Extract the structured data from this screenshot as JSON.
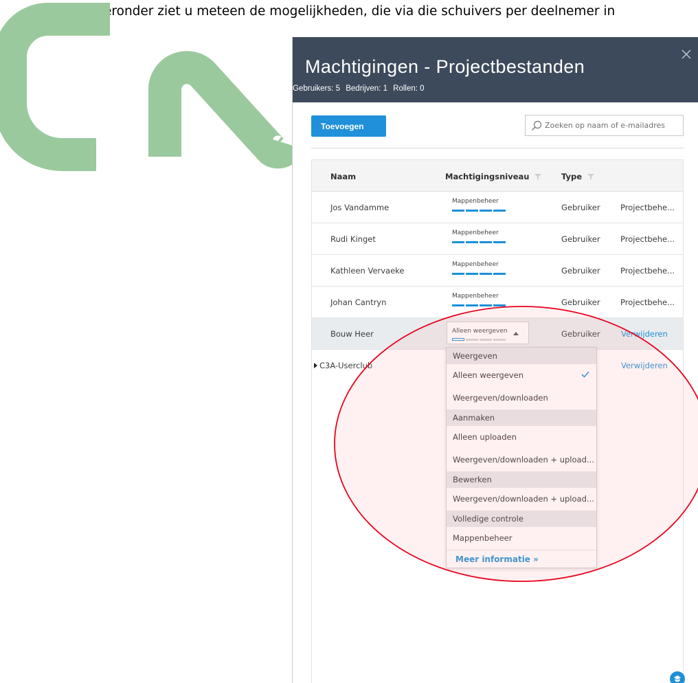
{
  "caption": "Hieronder ziet u meteen de mogelijkheden, die via die schuivers per deelnemer in",
  "colors": {
    "logo_green": "#9bc99e",
    "header_bg": "#3d4a5c",
    "accent": "#1f90d9",
    "annotation": "#e8001c"
  },
  "panel": {
    "title": "Machtigingen - Projectbestanden",
    "stats": [
      "Gebruikers: 5",
      "Bedrijven: 1",
      "Rollen: 0"
    ],
    "close_icon": "close-icon",
    "add_button": "Toevoegen",
    "search_placeholder": "Zoeken op naam of e-mailadres"
  },
  "table": {
    "columns": {
      "name": "Naam",
      "level": "Machtigingsniveau",
      "type": "Type"
    },
    "rows": [
      {
        "name": "Jos Vandamme",
        "level": "Mappenbeheer",
        "level_value": "4/4",
        "type": "Gebruiker",
        "role": "Projectbehe..."
      },
      {
        "name": "Rudi Kinget",
        "level": "Mappenbeheer",
        "level_value": "4/4",
        "type": "Gebruiker",
        "role": "Projectbehe..."
      },
      {
        "name": "Kathleen Vervaeke",
        "level": "Mappenbeheer",
        "level_value": "4/4",
        "type": "Gebruiker",
        "role": "Projectbehe..."
      },
      {
        "name": "Johan Cantryn",
        "level": "Mappenbeheer",
        "level_value": "4/4",
        "type": "Gebruiker",
        "role": "Projectbehe..."
      },
      {
        "name": "Bouw Heer",
        "level": "Alleen weergeven",
        "level_value": "1/4",
        "type": "Gebruiker",
        "action": "Verwijderen"
      },
      {
        "name": "C3A-Userclub",
        "action": "Verwijderen"
      }
    ]
  },
  "dropdown": {
    "groups": [
      {
        "label": "Weergeven",
        "items": [
          "Alleen weergeven",
          "Weergeven/downloaden"
        ]
      },
      {
        "label": "Aanmaken",
        "items": [
          "Alleen uploaden",
          "Weergeven/downloaden + upload..."
        ]
      },
      {
        "label": "Bewerken",
        "items": [
          "Weergeven/downloaden + upload..."
        ]
      },
      {
        "label": "Volledige controle",
        "items": [
          "Mappenbeheer"
        ]
      }
    ],
    "selected": "Alleen weergeven",
    "footer_link": "Meer informatie »"
  }
}
